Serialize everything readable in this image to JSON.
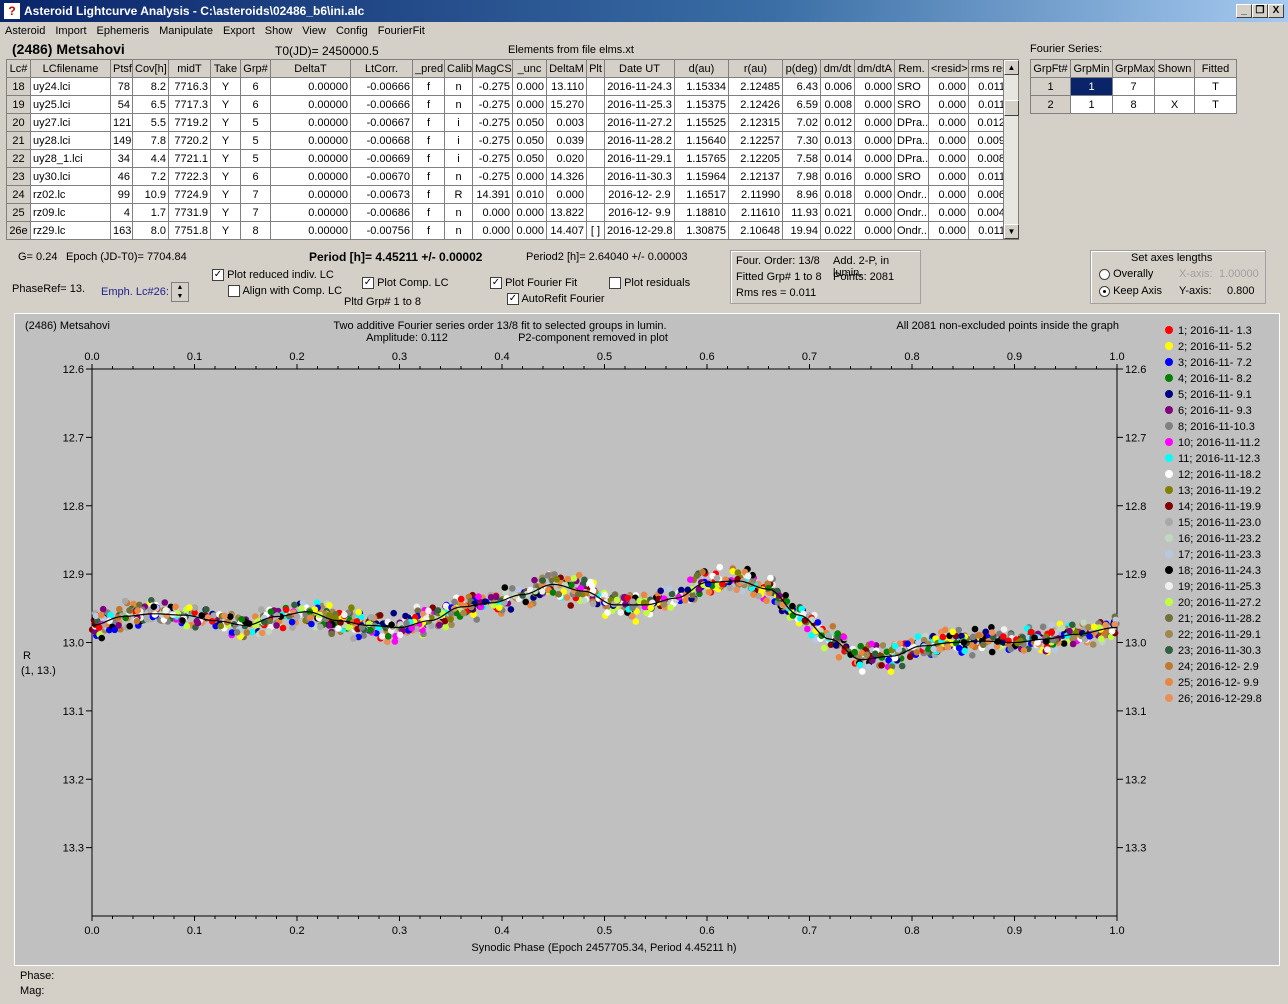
{
  "window": {
    "title": "Asteroid Lightcurve Analysis - C:\\asteroids\\02486_b6\\ini.alc",
    "icon": "app-logo-icon",
    "buttons": [
      "_",
      "\u0011",
      "X"
    ]
  },
  "menu": [
    "Asteroid",
    "Import",
    "Ephemeris",
    "Manipulate",
    "Export",
    "Show",
    "View",
    "Config",
    "FourierFit"
  ],
  "header": {
    "asteroid": "(2486) Metsahovi",
    "t0": "T0(JD)= 2450000.5",
    "elements": "Elements from file elms.xt"
  },
  "lc_table": {
    "columns": [
      "Lc#",
      "LCfilename",
      "Ptsf",
      "Cov[h]",
      "midT",
      "Take",
      "Grp#",
      "DeltaT",
      "LtCorr.",
      "_pred.",
      "Calib",
      "MagCS",
      "_unc",
      "DeltaM",
      "Plt",
      "Date UT",
      "d(au)",
      "r(au)",
      "p(deg)",
      "dm/dt",
      "dm/dtA",
      "Rem.",
      "<resid>",
      "rms res"
    ],
    "rows": [
      [
        "18",
        "uy24.lci",
        "78",
        "8.2",
        "7716.3",
        "Y",
        "6",
        "0.00000",
        "-0.00666",
        "f",
        "n",
        "-0.275",
        "0.000",
        "13.110",
        "",
        "2016-11-24.3",
        "1.15334",
        "2.12485",
        "6.43",
        "0.006",
        "0.000",
        "SRO",
        "0.000",
        "0.011"
      ],
      [
        "19",
        "uy25.lci",
        "54",
        "6.5",
        "7717.3",
        "Y",
        "6",
        "0.00000",
        "-0.00666",
        "f",
        "n",
        "-0.275",
        "0.000",
        "15.270",
        "",
        "2016-11-25.3",
        "1.15375",
        "2.12426",
        "6.59",
        "0.008",
        "0.000",
        "SRO",
        "0.000",
        "0.011"
      ],
      [
        "20",
        "uy27.lci",
        "121",
        "5.5",
        "7719.2",
        "Y",
        "5",
        "0.00000",
        "-0.00667",
        "f",
        "i",
        "-0.275",
        "0.050",
        "0.003",
        "",
        "2016-11-27.2",
        "1.15525",
        "2.12315",
        "7.02",
        "0.012",
        "0.000",
        "DPra...",
        "0.000",
        "0.012"
      ],
      [
        "21",
        "uy28.lci",
        "149",
        "7.8",
        "7720.2",
        "Y",
        "5",
        "0.00000",
        "-0.00668",
        "f",
        "i",
        "-0.275",
        "0.050",
        "0.039",
        "",
        "2016-11-28.2",
        "1.15640",
        "2.12257",
        "7.30",
        "0.013",
        "0.000",
        "DPra...",
        "0.000",
        "0.009"
      ],
      [
        "22",
        "uy28_1.lci",
        "34",
        "4.4",
        "7721.1",
        "Y",
        "5",
        "0.00000",
        "-0.00669",
        "f",
        "i",
        "-0.275",
        "0.050",
        "0.020",
        "",
        "2016-11-29.1",
        "1.15765",
        "2.12205",
        "7.58",
        "0.014",
        "0.000",
        "DPra...",
        "0.000",
        "0.008"
      ],
      [
        "23",
        "uy30.lci",
        "46",
        "7.2",
        "7722.3",
        "Y",
        "6",
        "0.00000",
        "-0.00670",
        "f",
        "n",
        "-0.275",
        "0.000",
        "14.326",
        "",
        "2016-11-30.3",
        "1.15964",
        "2.12137",
        "7.98",
        "0.016",
        "0.000",
        "SRO",
        "0.000",
        "0.011"
      ],
      [
        "24",
        "rz02.lc",
        "99",
        "10.9",
        "7724.9",
        "Y",
        "7",
        "0.00000",
        "-0.00673",
        "f",
        "R",
        "14.391",
        "0.010",
        "0.000",
        "",
        "2016-12- 2.9",
        "1.16517",
        "2.11990",
        "8.96",
        "0.018",
        "0.000",
        "Ondr...",
        "0.000",
        "0.006"
      ],
      [
        "25",
        "rz09.lc",
        "4",
        "1.7",
        "7731.9",
        "Y",
        "7",
        "0.00000",
        "-0.00686",
        "f",
        "n",
        "0.000",
        "0.000",
        "13.822",
        "",
        "2016-12- 9.9",
        "1.18810",
        "2.11610",
        "11.93",
        "0.021",
        "0.000",
        "Ondr...",
        "0.000",
        "0.004"
      ],
      [
        "26e",
        "rz29.lc",
        "163",
        "8.0",
        "7751.8",
        "Y",
        "8",
        "0.00000",
        "-0.00756",
        "f",
        "n",
        "0.000",
        "0.000",
        "14.407",
        "[ ]",
        "2016-12-29.8",
        "1.30875",
        "2.10648",
        "19.94",
        "0.022",
        "0.000",
        "Ondr...",
        "0.000",
        "0.011"
      ]
    ]
  },
  "fourier_series": {
    "label": "Fourier Series:",
    "columns": [
      "GrpFt#",
      "GrpMin",
      "GrpMax",
      "Shown",
      "Fitted"
    ],
    "rows": [
      [
        "1",
        "1",
        "7",
        "",
        "T"
      ],
      [
        "2",
        "1",
        "8",
        "X",
        "T"
      ]
    ]
  },
  "info": {
    "g": "G= 0.24",
    "epoch": "Epoch (JD-T0)= 7704.84",
    "period": "Period [h]= 4.45211 +/- 0.00002",
    "period2": "Period2 [h]= 2.64040 +/- 0.00003",
    "phaseref": "PhaseRef= 13.",
    "emph": "Emph. Lc#26:",
    "pltd": "Pltd Grp#  1  to   8"
  },
  "checkboxes": {
    "reduced": {
      "label": "Plot reduced indiv. LC",
      "checked": true
    },
    "align": {
      "label": "Align with Comp. LC",
      "checked": false
    },
    "comp": {
      "label": "Plot Comp. LC",
      "checked": true
    },
    "fourier": {
      "label": "Plot Fourier Fit",
      "checked": true
    },
    "residuals": {
      "label": "Plot residuals",
      "checked": false
    },
    "autorefit": {
      "label": "AutoRefit Fourier",
      "checked": true
    }
  },
  "fitinfo": {
    "order": "Four. Order: 13/8",
    "add": "Add. 2-P, in lumin.",
    "fitted": "Fitted Grp# 1 to 8",
    "points": "Points: 2081",
    "rms": "Rms res      = 0.011"
  },
  "axes": {
    "title": "Set axes lengths",
    "overally": "Overally",
    "keep": "Keep Axis",
    "xaxis_label": "X-axis:",
    "xaxis_value": "1.00000",
    "yaxis_label": "Y-axis:",
    "yaxis_value": "0.800"
  },
  "status": {
    "phase": "Phase:",
    "mag": "Mag:"
  },
  "chart_data": {
    "type": "scatter",
    "title_left": "(2486) Metsahovi",
    "title_center1": "Two additive Fourier series order 13/8 fit to selected groups in lumin.",
    "title_center2": "Amplitude: 0.112",
    "title_center3": "P2-component removed in plot",
    "title_right": "All 2081 non-excluded points inside the graph",
    "xlabel": "Synodic Phase (Epoch 2457705.34, Period 4.45211 h)",
    "ylabel": "R",
    "ylabel2": "(1, 13.)",
    "xlim": [
      0,
      1
    ],
    "ylim": [
      12.6,
      13.4
    ],
    "y_inverted": true,
    "xticks": [
      "0.0",
      "0.1",
      "0.2",
      "0.3",
      "0.4",
      "0.5",
      "0.6",
      "0.7",
      "0.8",
      "0.9",
      "1.0"
    ],
    "yticks": [
      "12.6",
      "12.7",
      "12.8",
      "12.9",
      "13.0",
      "13.1",
      "13.2",
      "13.3"
    ],
    "fit_curve": {
      "x": [
        0,
        0.03,
        0.06,
        0.09,
        0.12,
        0.15,
        0.18,
        0.21,
        0.24,
        0.27,
        0.3,
        0.33,
        0.36,
        0.39,
        0.42,
        0.45,
        0.48,
        0.51,
        0.54,
        0.57,
        0.6,
        0.63,
        0.66,
        0.69,
        0.72,
        0.75,
        0.78,
        0.81,
        0.84,
        0.87,
        0.9,
        0.93,
        0.96,
        1.0
      ],
      "y": [
        12.975,
        12.962,
        12.958,
        12.96,
        12.968,
        12.975,
        12.962,
        12.955,
        12.968,
        12.975,
        12.978,
        12.968,
        12.948,
        12.942,
        12.93,
        12.915,
        12.925,
        12.945,
        12.945,
        12.935,
        12.912,
        12.91,
        12.922,
        12.96,
        12.995,
        13.025,
        13.02,
        13.005,
        13.0,
        12.998,
        13.0,
        12.995,
        12.988,
        12.978
      ]
    },
    "series": [
      {
        "name": "1; 2016-11- 1.3",
        "color": "#ff0000"
      },
      {
        "name": "2; 2016-11- 5.2",
        "color": "#ffff00"
      },
      {
        "name": "3; 2016-11- 7.2",
        "color": "#0000ff"
      },
      {
        "name": "4; 2016-11- 8.2",
        "color": "#008000"
      },
      {
        "name": "5; 2016-11- 9.1",
        "color": "#000080"
      },
      {
        "name": "6; 2016-11- 9.3",
        "color": "#800080"
      },
      {
        "name": "8; 2016-11-10.3",
        "color": "#808080"
      },
      {
        "name": "10; 2016-11-11.2",
        "color": "#ff00ff"
      },
      {
        "name": "11; 2016-11-12.3",
        "color": "#00ffff"
      },
      {
        "name": "12; 2016-11-18.2",
        "color": "#ffffff"
      },
      {
        "name": "13; 2016-11-19.2",
        "color": "#808000"
      },
      {
        "name": "14; 2016-11-19.9",
        "color": "#800000"
      },
      {
        "name": "15; 2016-11-23.0",
        "color": "#a8a8a8"
      },
      {
        "name": "16; 2016-11-23.2",
        "color": "#c0d8c0"
      },
      {
        "name": "17; 2016-11-23.3",
        "color": "#b8c8e0"
      },
      {
        "name": "18; 2016-11-24.3",
        "color": "#000000"
      },
      {
        "name": "19; 2016-11-25.3",
        "color": "#f0f0f0"
      },
      {
        "name": "20; 2016-11-27.2",
        "color": "#c0ff40"
      },
      {
        "name": "21; 2016-11-28.2",
        "color": "#70703a"
      },
      {
        "name": "22; 2016-11-29.1",
        "color": "#a08850"
      },
      {
        "name": "23; 2016-11-30.3",
        "color": "#306040"
      },
      {
        "name": "24; 2016-12- 2.9",
        "color": "#c07830"
      },
      {
        "name": "25; 2016-12- 9.9",
        "color": "#e88840"
      },
      {
        "name": "26; 2016-12-29.8",
        "color": "#e89058"
      }
    ]
  }
}
